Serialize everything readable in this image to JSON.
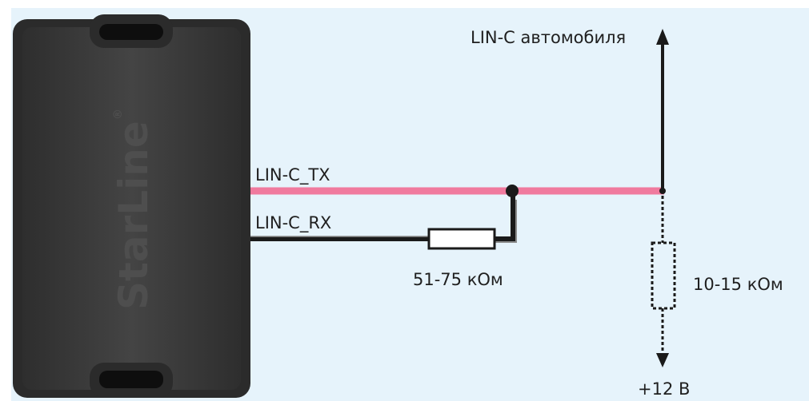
{
  "device": {
    "brand": "StarLine",
    "trademark": "®"
  },
  "signals": {
    "lin_tx": "LIN-C_TX",
    "lin_rx": "LIN-C_RX",
    "car_lin": "LIN-C автомобиля"
  },
  "components": {
    "resistor_series": "51-75 кОм",
    "resistor_pullup": "10-15 кОм",
    "supply": "+12 В"
  },
  "colors": {
    "background": "#e6f3fb",
    "device_body": "#3a3a3a",
    "tx_wire": "#f07a9e",
    "rx_wire": "#555555",
    "wire": "#1a1a1a"
  }
}
